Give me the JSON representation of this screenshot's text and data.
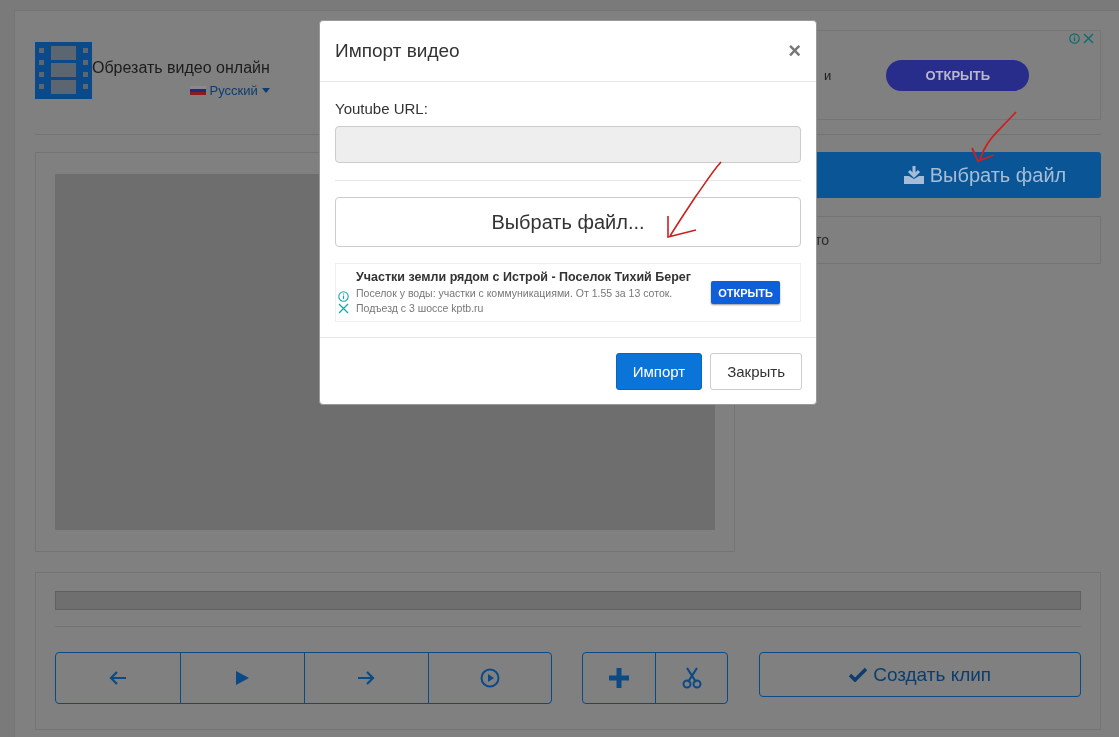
{
  "header": {
    "title": "Обрезать видео онлайн",
    "language": "Русский"
  },
  "top_ad": {
    "text_fragment": "и",
    "button": "ОТКРЫТЬ"
  },
  "choose_file_button": "Выбрать файл",
  "file_info": "то",
  "create_clip_button": "Создать клип",
  "modal": {
    "title": "Импорт видео",
    "close": "×",
    "url_label": "Youtube URL:",
    "choose_file_button": "Выбрать файл...",
    "ad": {
      "title": "Участки земли рядом с Истрой - Поселок Тихий Берег",
      "text": "Поселок у воды: участки с коммуникациями. От 1.55 за 13 соток. Подъезд с 3 шоссе kptb.ru",
      "button": "ОТКРЫТЬ"
    },
    "buttons": [
      {
        "label": "Импорт",
        "kind": "primary"
      },
      {
        "label": "Закрыть",
        "kind": "default"
      }
    ]
  }
}
